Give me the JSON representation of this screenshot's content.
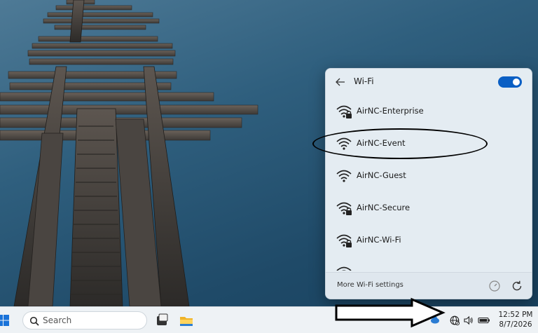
{
  "wifi_panel": {
    "title": "Wi-Fi",
    "toggle_on": true,
    "networks": [
      {
        "name": "AirNC-Enterprise",
        "secured": true
      },
      {
        "name": "AirNC-Event",
        "secured": false
      },
      {
        "name": "AirNC-Guest",
        "secured": false
      },
      {
        "name": "AirNC-Secure",
        "secured": true
      },
      {
        "name": "AirNC-Wi-Fi",
        "secured": true
      }
    ],
    "more_settings_label": "More Wi-Fi settings"
  },
  "taskbar": {
    "search_placeholder": "Search",
    "time": "12:52 PM",
    "date": "8/7/2026"
  },
  "colors": {
    "accent": "#0a5fc4",
    "panel_bg": "#e4ecf2",
    "taskbar_bg": "#eef2f5"
  },
  "icons": [
    "back-arrow-icon",
    "wifi-icon",
    "lock-icon",
    "speedometer-icon",
    "refresh-icon",
    "windows-start-icon",
    "search-icon",
    "task-view-icon",
    "file-explorer-icon",
    "network-globe-icon",
    "volume-icon",
    "battery-icon"
  ]
}
